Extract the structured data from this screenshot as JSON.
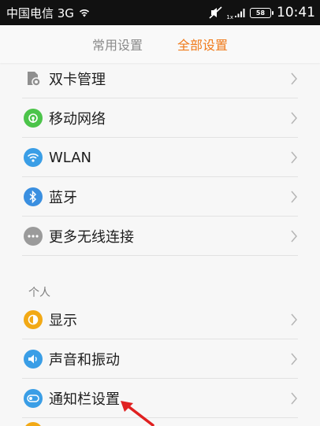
{
  "status_bar": {
    "carrier": "中国电信 3G",
    "signal_label": "1x",
    "battery": "58",
    "time": "10:41"
  },
  "tabs": [
    {
      "label": "常用设置",
      "active": false
    },
    {
      "label": "全部设置",
      "active": true
    }
  ],
  "colors": {
    "accent": "#f07a1a",
    "status_bar": "#111111",
    "text": "#1e1e1e",
    "secondary_text": "#7d7d7d"
  },
  "wireless_section": {
    "items": [
      {
        "label": "双卡管理",
        "icon": "sim-card-icon"
      },
      {
        "label": "移动网络",
        "icon": "mobile-network-icon"
      },
      {
        "label": "WLAN",
        "icon": "wifi-icon"
      },
      {
        "label": "蓝牙",
        "icon": "bluetooth-icon"
      },
      {
        "label": "更多无线连接",
        "icon": "more-icon"
      }
    ]
  },
  "personal_section": {
    "title": "个人",
    "items": [
      {
        "label": "显示",
        "icon": "display-icon"
      },
      {
        "label": "声音和振动",
        "icon": "sound-icon"
      },
      {
        "label": "通知栏设置",
        "icon": "notification-toggle-icon"
      }
    ]
  }
}
